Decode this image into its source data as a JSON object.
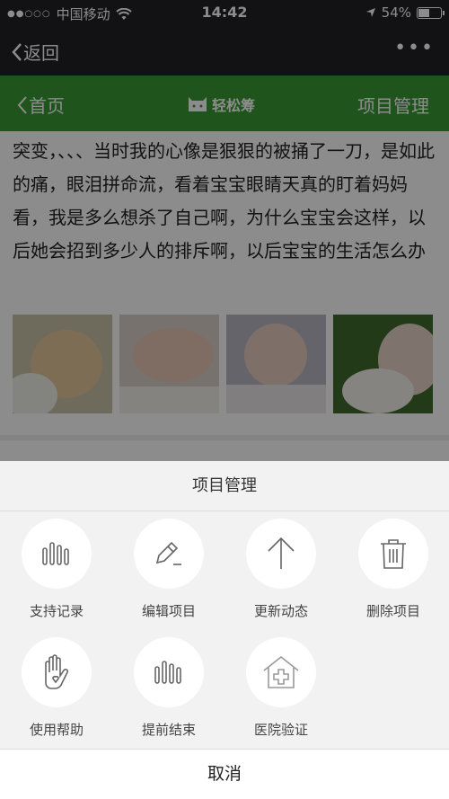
{
  "status": {
    "signal_dots": "●●○○○",
    "carrier": "中国移动",
    "time": "14:42",
    "battery": "54%",
    "battery_level": 0.54
  },
  "nav": {
    "back_label": "返回",
    "more": "•••"
  },
  "header": {
    "back_label": "首页",
    "logo_text": "轻松筹",
    "right_label": "项目管理"
  },
  "article": {
    "text": "突变，、、、当时我的心像是狠狠的被捅了一刀，是如此的痛，眼泪拼命流，看着宝宝眼睛天真的盯着妈妈看，我是多么想杀了自己啊，为什么宝宝会这样，以后她会招到多少人的排斥啊，以后宝宝的生活怎么办"
  },
  "sheet": {
    "title": "项目管理",
    "items": [
      {
        "label": "支持记录",
        "icon": "bars-icon"
      },
      {
        "label": "编辑项目",
        "icon": "pencil-icon"
      },
      {
        "label": "更新动态",
        "icon": "arrow-up-icon"
      },
      {
        "label": "删除项目",
        "icon": "trash-icon"
      },
      {
        "label": "使用帮助",
        "icon": "hand-heart-icon"
      },
      {
        "label": "提前结束",
        "icon": "bars-icon"
      },
      {
        "label": "医院验证",
        "icon": "hospital-icon"
      }
    ],
    "cancel_label": "取消"
  }
}
